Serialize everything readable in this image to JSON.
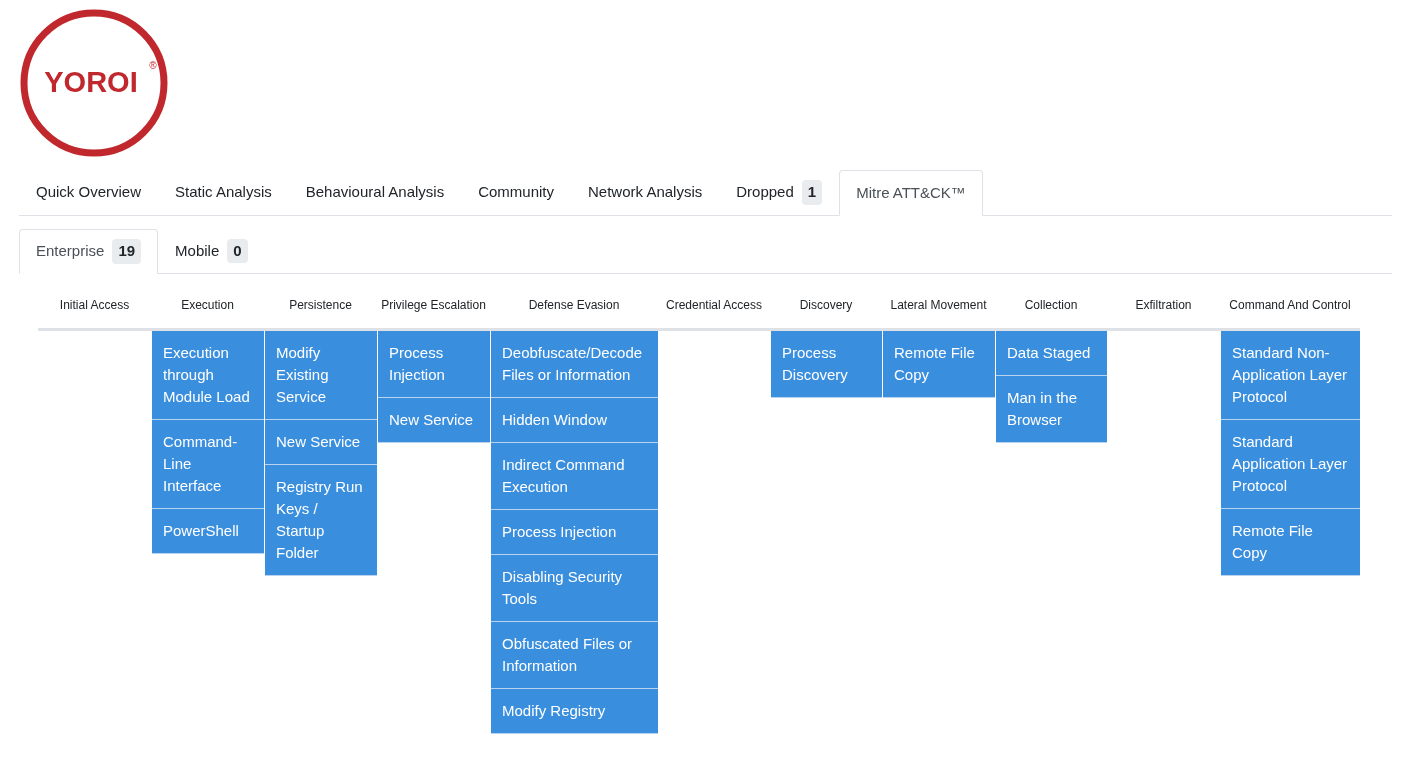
{
  "logo": {
    "text": "YOROI",
    "mark": "®"
  },
  "tabs": [
    {
      "label": "Quick Overview",
      "selected": false
    },
    {
      "label": "Static Analysis",
      "selected": false
    },
    {
      "label": "Behavioural Analysis",
      "selected": false
    },
    {
      "label": "Community",
      "selected": false
    },
    {
      "label": "Network Analysis",
      "selected": false
    },
    {
      "label": "Dropped",
      "badge": "1",
      "selected": false
    },
    {
      "label": "Mitre ATT&CK™",
      "selected": true
    }
  ],
  "subtabs": [
    {
      "label": "Enterprise",
      "badge": "19",
      "selected": true
    },
    {
      "label": "Mobile",
      "badge": "0",
      "selected": false
    }
  ],
  "tactics": [
    {
      "name": "Initial Access"
    },
    {
      "name": "Execution",
      "techniques": [
        "Execution through Module Load",
        "Command-Line Interface",
        "PowerShell"
      ]
    },
    {
      "name": "Persistence",
      "techniques": [
        "Modify Existing Service",
        "New Service",
        "Registry Run Keys / Startup Folder"
      ]
    },
    {
      "name": "Privilege Escalation",
      "techniques": [
        "Process Injection",
        "New Service"
      ]
    },
    {
      "name": "Defense Evasion",
      "techniques": [
        "Deobfuscate/Decode Files or Information",
        "Hidden Window",
        "Indirect Command Execution",
        "Process Injection",
        "Disabling Security Tools",
        "Obfuscated Files or Information",
        "Modify Registry"
      ]
    },
    {
      "name": "Credential Access"
    },
    {
      "name": "Discovery",
      "techniques": [
        "Process Discovery"
      ]
    },
    {
      "name": "Lateral Movement",
      "techniques": [
        "Remote File Copy"
      ]
    },
    {
      "name": "Collection",
      "techniques": [
        "Data Staged",
        "Man in the Browser"
      ]
    },
    {
      "name": "Exfiltration"
    },
    {
      "name": "Command And Control",
      "techniques": [
        "Standard Non-Application Layer Protocol",
        "Standard Application Layer Protocol",
        "Remote File Copy"
      ]
    }
  ]
}
